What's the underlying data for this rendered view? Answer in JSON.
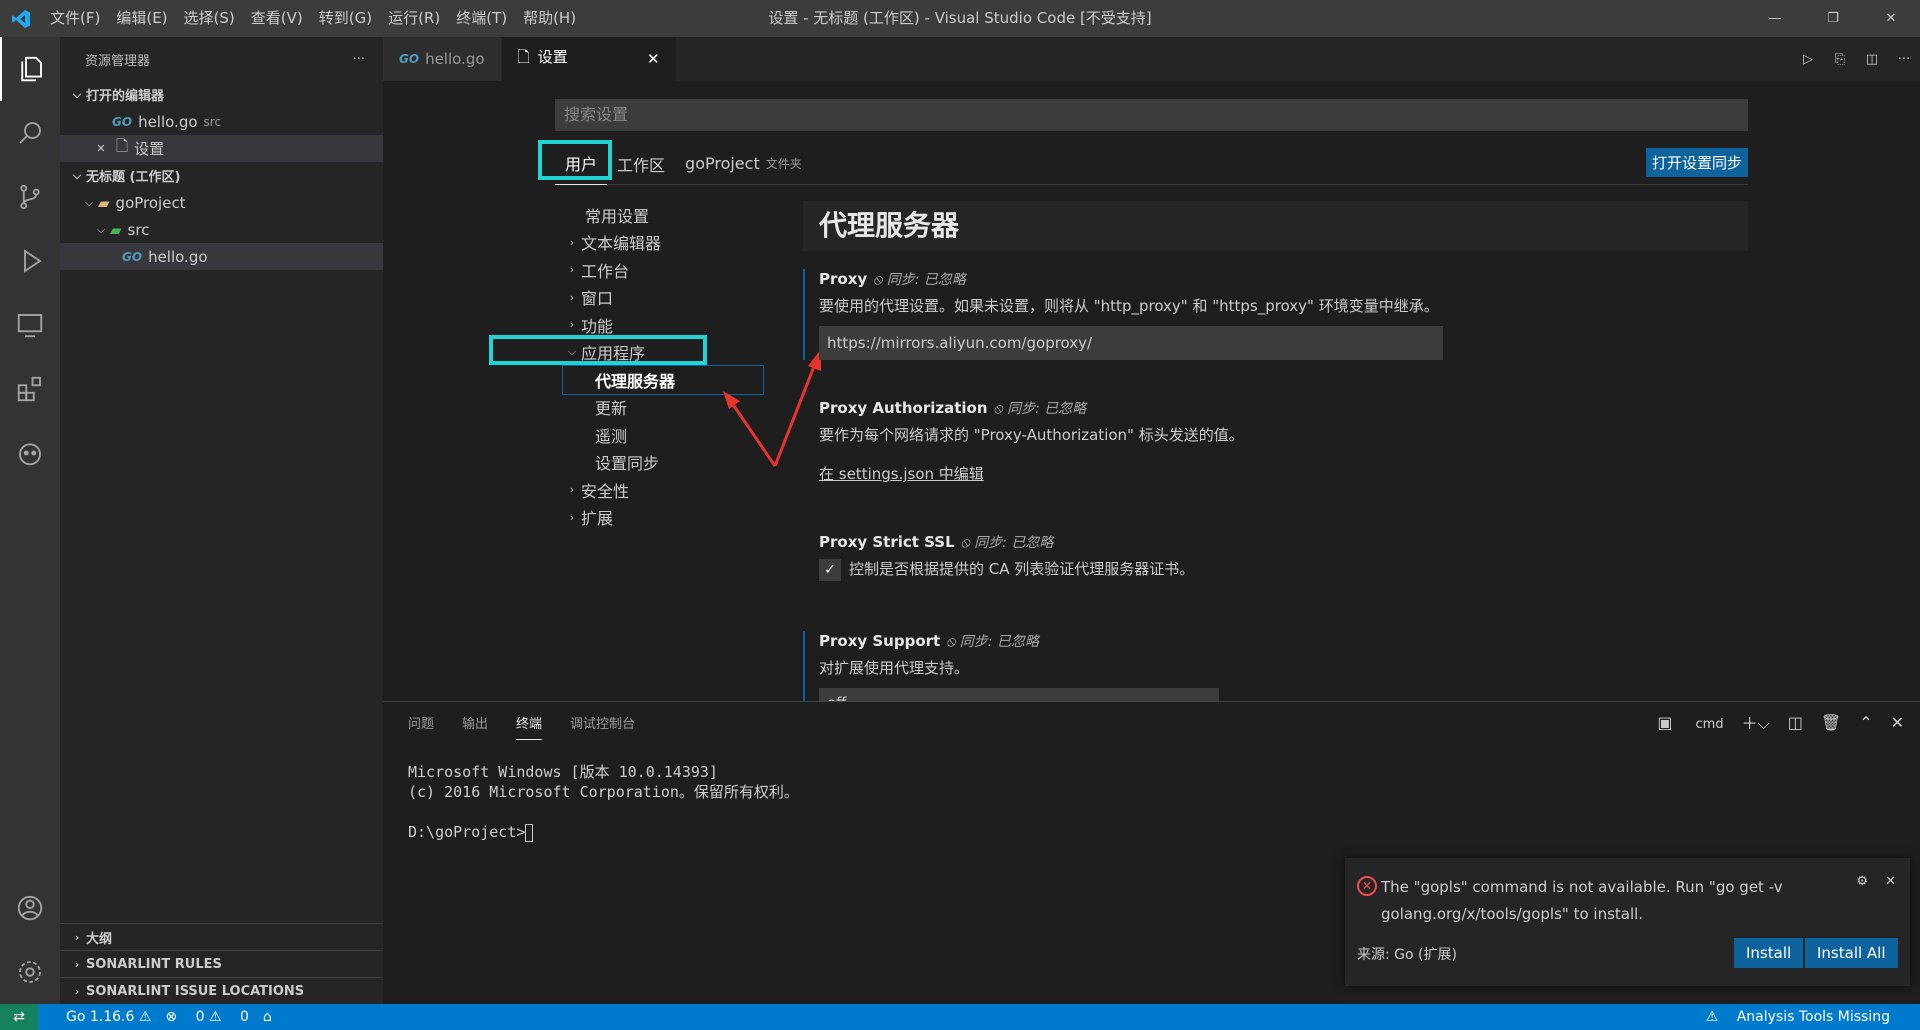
{
  "titlebar": {
    "menus": [
      "文件(F)",
      "编辑(E)",
      "选择(S)",
      "查看(V)",
      "转到(G)",
      "运行(R)",
      "终端(T)",
      "帮助(H)"
    ],
    "title": "设置 - 无标题 (工作区) - Visual Studio Code [不受支持]"
  },
  "sidebar": {
    "header": "资源管理器",
    "open_editors": "打开的编辑器",
    "open_files": [
      {
        "name": "hello.go",
        "desc": "src"
      },
      {
        "name": "设置"
      }
    ],
    "workspace": "无标题 (工作区)",
    "project": "goProject",
    "folder": "src",
    "file": "hello.go",
    "bottom": [
      "大纲",
      "SONARLINT RULES",
      "SONARLINT ISSUE LOCATIONS"
    ]
  },
  "tabs": [
    {
      "label": "hello.go"
    },
    {
      "label": "设置"
    }
  ],
  "settings": {
    "search_placeholder": "搜索设置",
    "scopes": {
      "user": "用户",
      "workspace": "工作区",
      "folder": "goProject",
      "folder_tag": "文件夹"
    },
    "sync_button": "打开设置同步",
    "toc": [
      "常用设置",
      "文本编辑器",
      "工作台",
      "窗口",
      "功能",
      "应用程序",
      "代理服务器",
      "更新",
      "遥测",
      "设置同步",
      "安全性",
      "扩展"
    ],
    "category": "代理服务器",
    "sync_ignored": "同步: 已忽略",
    "items": [
      {
        "title": "Proxy",
        "desc": "要使用的代理设置。如果未设置，则将从 \"http_proxy\" 和 \"https_proxy\" 环境变量中继承。",
        "value": "https://mirrors.aliyun.com/goproxy/"
      },
      {
        "title": "Proxy Authorization",
        "desc": "要作为每个网络请求的 \"Proxy-Authorization\" 标头发送的值。",
        "link": "在 settings.json 中编辑"
      },
      {
        "title": "Proxy Strict SSL",
        "desc": "控制是否根据提供的 CA 列表验证代理服务器证书。"
      },
      {
        "title": "Proxy Support",
        "desc": "对扩展使用代理支持。",
        "value": "off"
      }
    ]
  },
  "panel": {
    "tabs": [
      "问题",
      "输出",
      "终端",
      "调试控制台"
    ],
    "shell": "cmd",
    "terminal": [
      "Microsoft Windows [版本 10.0.14393]",
      "(c) 2016 Microsoft Corporation。保留所有权利。",
      "",
      "D:\\goProject>"
    ]
  },
  "notification": {
    "message": "The \"gopls\" command is not available. Run \"go get -v golang.org/x/tools/gopls\" to install.",
    "source": "来源: Go (扩展)",
    "install": "Install",
    "install_all": "Install All"
  },
  "status": {
    "go": "Go 1.16.6",
    "errors": "0",
    "warnings": "0",
    "right": "Analysis Tools Missing"
  },
  "colors": {
    "accent": "#007acc",
    "highlight": "#21d3d3",
    "arrow": "#e8322e"
  }
}
